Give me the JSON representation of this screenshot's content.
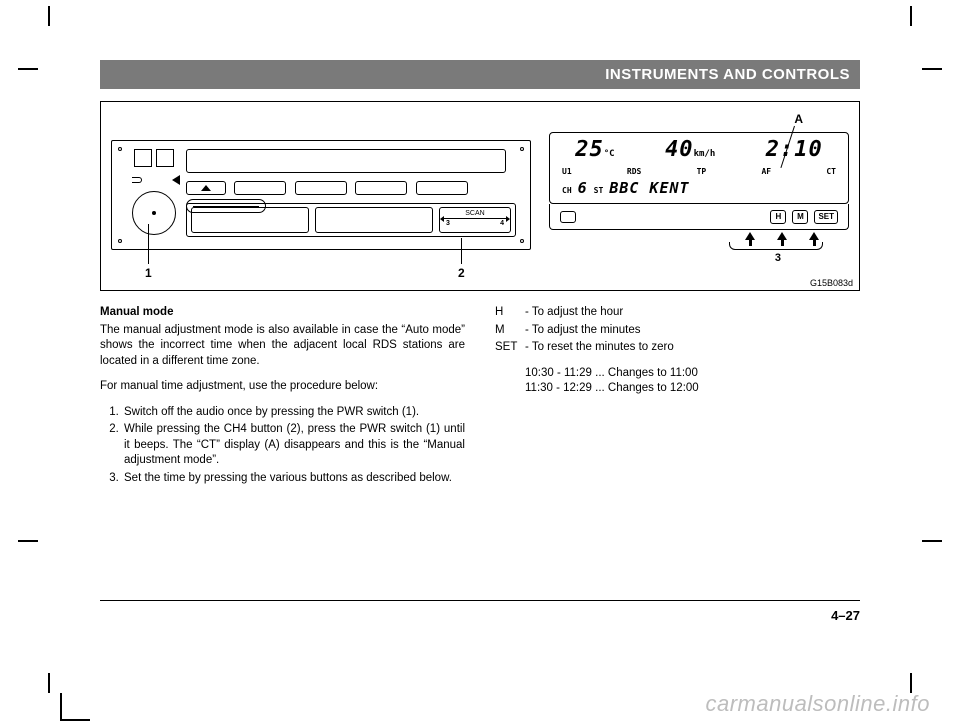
{
  "header": {
    "title": "INSTRUMENTS AND CONTROLS"
  },
  "figure": {
    "scan_label": "SCAN",
    "scan_num_left": "3",
    "scan_num_right": "4",
    "callout_1": "1",
    "callout_2": "2",
    "callout_3": "3",
    "callout_A": "A",
    "code": "G15B083d"
  },
  "cluster": {
    "temp_value": "25",
    "temp_unit": "°C",
    "speed_value": "40",
    "speed_unit": "km/h",
    "clock": "2:10",
    "flags": [
      "U1",
      "RDS",
      "TP",
      "AF",
      "CT"
    ],
    "ch_label": "CH",
    "ch_value": "6",
    "st_label": "ST",
    "station": "BBC KENT",
    "btn_h": "H",
    "btn_m": "M",
    "btn_set": "SET"
  },
  "body": {
    "manual_mode_heading": "Manual mode",
    "manual_mode_p1": "The manual adjustment mode is also available in case the “Auto mode” shows the incorrect time when the adjacent local RDS stations are located in a different time zone.",
    "manual_mode_p2": "For manual time adjustment, use the procedure below:",
    "steps": [
      "Switch off the audio once by pressing the PWR switch (1).",
      "While pressing the CH4 button (2), press the PWR switch (1) until it beeps. The “CT” display (A) disappears and this is the “Manual adjustment mode”.",
      "Set the time by pressing the various buttons as described below."
    ],
    "defs": [
      {
        "k": "H",
        "v": "- To adjust the hour"
      },
      {
        "k": "M",
        "v": "- To adjust the minutes"
      },
      {
        "k": "SET",
        "v": "- To reset the minutes to zero"
      }
    ],
    "examples": [
      "10:30 - 11:29 ... Changes to 11:00",
      "11:30 - 12:29 ... Changes to 12:00"
    ]
  },
  "page_number": "4–27",
  "watermark": "carmanualsonline.info"
}
